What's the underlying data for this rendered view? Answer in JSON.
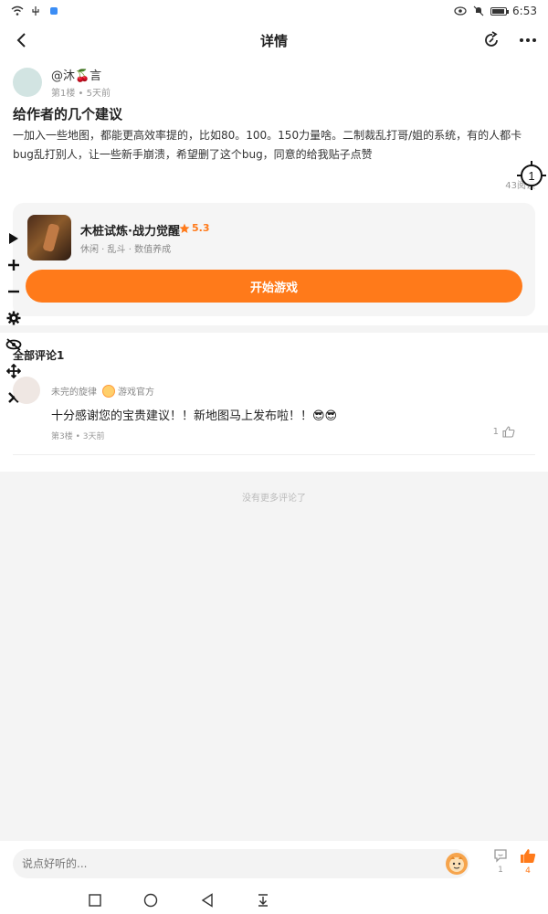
{
  "status_bar": {
    "time": "6:53",
    "battery_level": 0.9
  },
  "header": {
    "title": "详情"
  },
  "post": {
    "author": "@沐🍒言",
    "meta": "第1楼 • 5天前",
    "title": "给作者的几个建议",
    "body": "一加入一些地图，都能更高效率提的，比如80。100。150力量啥。二制裁乱打哥/姐的系统，有的人都卡bug乱打别人，让一些新手崩溃，希望删了这个bug，同意的给我贴子点赞",
    "views": "43阅读"
  },
  "game_card": {
    "name": "木桩试炼·战力觉醒",
    "rating": "5.3",
    "tags": "休闲 · 乱斗 · 数值养成",
    "play_label": "开始游戏"
  },
  "comments": {
    "title": "全部评论1",
    "items": [
      {
        "user": "未完的旋律",
        "badge": "游戏官方",
        "text": "十分感谢您的宝贵建议！！新地图马上发布啦！！😎😎",
        "meta": "第3楼 • 3天前",
        "likes": "1"
      }
    ],
    "no_more": "没有更多评论了"
  },
  "bottom_bar": {
    "placeholder": "说点好听的...",
    "reply_count": "1",
    "like_count": "4"
  },
  "colors": {
    "accent": "#ff7a1a",
    "background": "#f4f4f4"
  },
  "icons": {
    "back": "back-arrow-icon",
    "share": "share-icon",
    "more": "more-dots-icon",
    "star": "star-icon",
    "like": "thumbs-up-icon",
    "reply": "comment-icon"
  }
}
